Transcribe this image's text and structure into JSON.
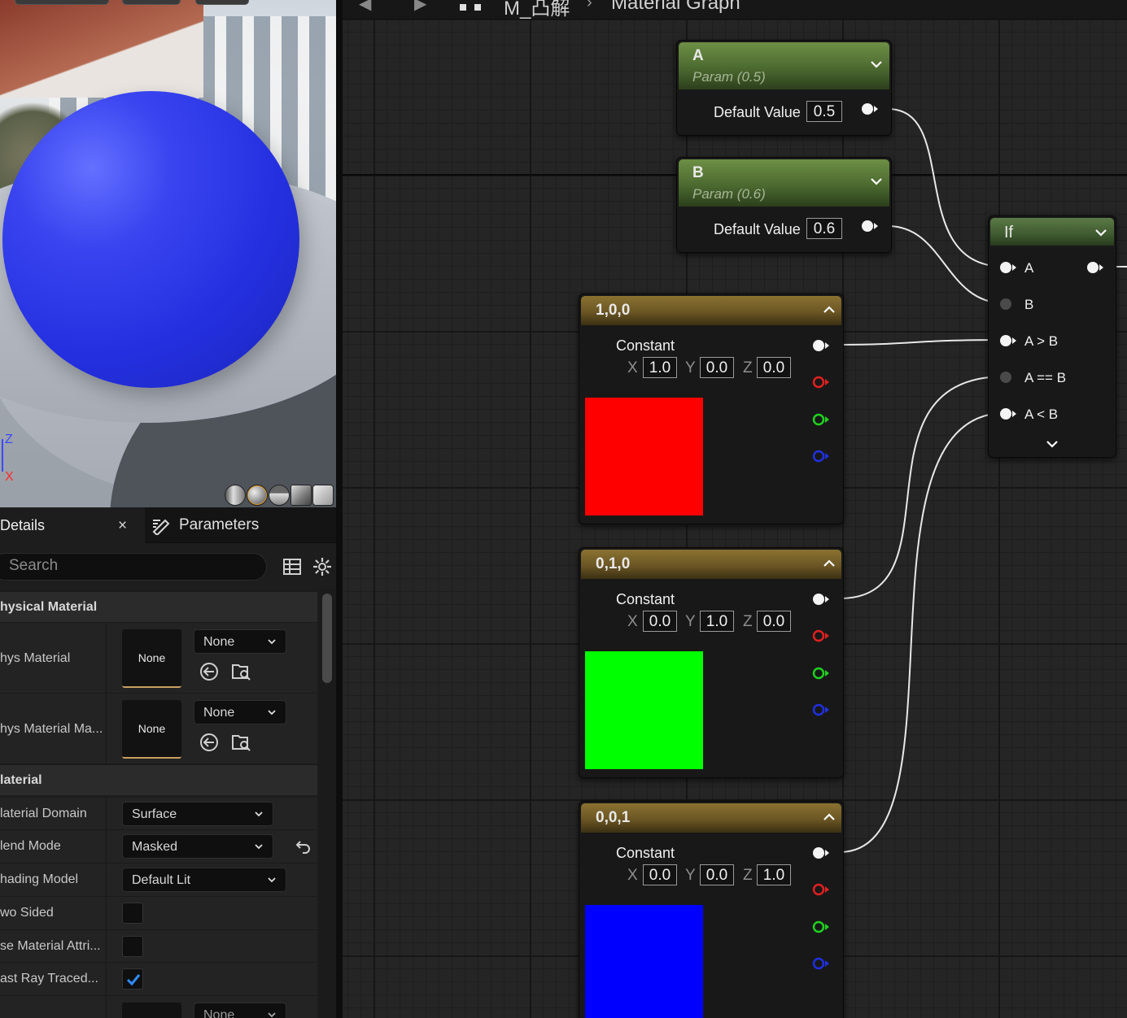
{
  "viewport": {
    "axis_z": "Z",
    "axis_x": "X",
    "preview_shapes": [
      "cylinder-icon",
      "sphere-icon",
      "plane-icon",
      "cube-icon",
      "custom-mesh-icon"
    ]
  },
  "details": {
    "tab_details": "Details",
    "tab_close": "×",
    "tab_parameters": "Parameters",
    "search_placeholder": "Search",
    "categories": {
      "physical": "hysical Material",
      "material": "laterial"
    },
    "phys_material": {
      "label": "hys Material",
      "thumb": "None",
      "combo": "None"
    },
    "phys_material_mask": {
      "label": "hys Material Ma...",
      "thumb": "None",
      "combo": "None"
    },
    "material_domain": {
      "label": "laterial Domain",
      "value": "Surface"
    },
    "blend_mode": {
      "label": "lend Mode",
      "value": "Masked"
    },
    "shading_model": {
      "label": "hading Model",
      "value": "Default Lit"
    },
    "two_sided": {
      "label": "wo Sided",
      "checked": false
    },
    "use_material_attr": {
      "label": "se Material Attri...",
      "checked": false
    },
    "cast_ray_traced": {
      "label": "ast Ray Traced...",
      "checked": true
    },
    "last_row_combo": "None"
  },
  "graph": {
    "breadcrumb": {
      "material": "M_凸解",
      "graph": "Material Graph"
    },
    "node_a": {
      "title": "A",
      "subtitle": "Param (0.5)",
      "field_label": "Default Value",
      "value": "0.5"
    },
    "node_b": {
      "title": "B",
      "subtitle": "Param (0.6)",
      "field_label": "Default Value",
      "value": "0.6"
    },
    "node_if": {
      "title": "If",
      "inputs": [
        "A",
        "B",
        "A > B",
        "A == B",
        "A < B"
      ]
    },
    "const_red": {
      "title": "1,0,0",
      "label": "Constant",
      "x": "1.0",
      "y": "0.0",
      "z": "0.0",
      "color": "#ff0000"
    },
    "const_green": {
      "title": "0,1,0",
      "label": "Constant",
      "x": "0.0",
      "y": "1.0",
      "z": "0.0",
      "color": "#00ff00"
    },
    "const_blue": {
      "title": "0,0,1",
      "label": "Constant",
      "x": "0.0",
      "y": "0.0",
      "z": "1.0",
      "color": "#0000ff"
    },
    "axis_letters": {
      "x": "X",
      "y": "Y",
      "z": "Z"
    }
  }
}
